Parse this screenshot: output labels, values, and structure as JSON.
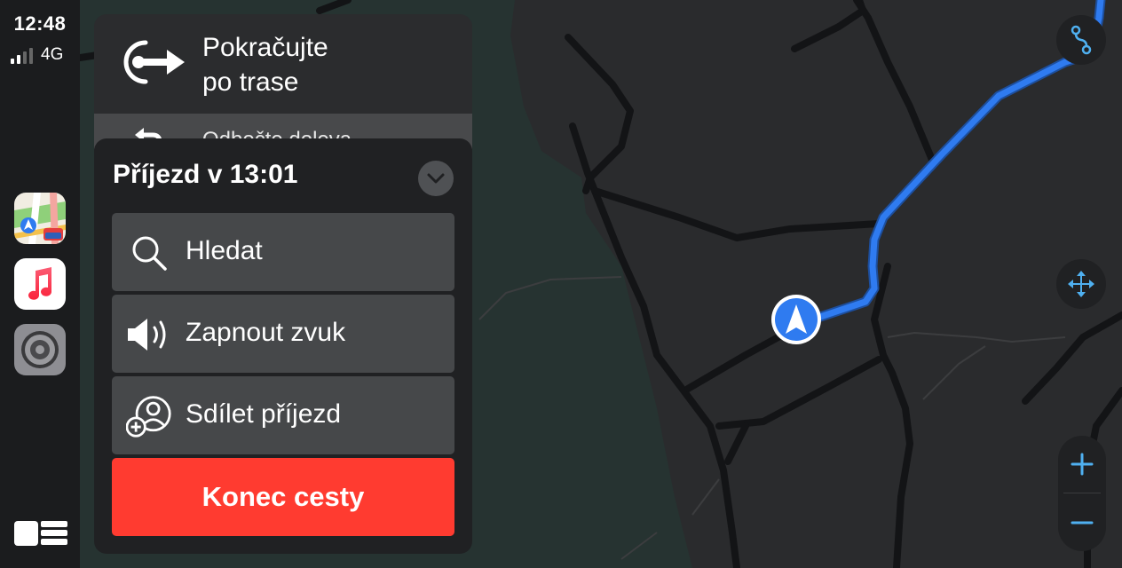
{
  "status_bar": {
    "time": "12:48",
    "network": "4G"
  },
  "dock": {
    "apps": [
      {
        "name": "Mapy",
        "icon": "maps-app-icon"
      },
      {
        "name": "Hudba",
        "icon": "music-app-icon"
      },
      {
        "name": "Nastavení",
        "icon": "settings-app-icon"
      }
    ],
    "dashboard_icon": "dashboard-grid-icon"
  },
  "maneuver": {
    "line1": "Pokračujte",
    "line2": "po trase",
    "next_instruction": "Odbočte doleva",
    "icon": "continue-route-arrow-icon",
    "next_icon": "turn-left-icon"
  },
  "arrival_panel": {
    "eta": "Příjezd v 13:01",
    "collapse_icon": "chevron-down-icon",
    "items": [
      {
        "label": "Hledat",
        "icon": "search-icon"
      },
      {
        "label": "Zapnout zvuk",
        "icon": "speaker-icon"
      },
      {
        "label": "Sdílet příjezd",
        "icon": "share-eta-icon"
      }
    ],
    "end_label": "Konec cesty"
  },
  "map_controls": {
    "route_overview_icon": "route-overview-icon",
    "pan_icon": "pan-arrows-icon",
    "zoom_in_icon": "plus-icon",
    "zoom_out_icon": "minus-icon"
  },
  "colors": {
    "accent_blue": "#2f7bf0",
    "end_red": "#ff3b30",
    "map_land": "#2a2b2d",
    "map_park": "#263331",
    "map_road": "#131416",
    "control_blue": "#4fb0f0"
  }
}
